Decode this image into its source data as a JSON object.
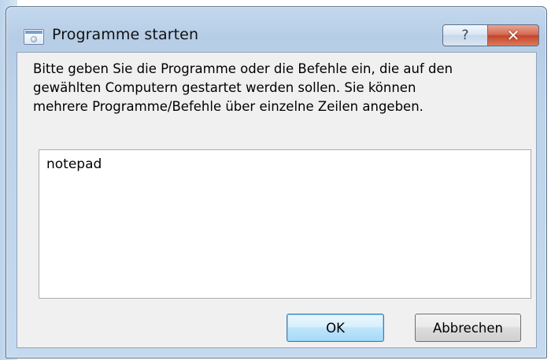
{
  "window": {
    "title": "Programme starten",
    "help_label": "?",
    "close_label": "✕"
  },
  "dialog": {
    "instruction_lines": [
      "Bitte geben Sie die Programme oder die Befehle ein, die auf den",
      "gewählten Computern gestartet werden sollen. Sie können",
      "mehrere Programme/Befehle über einzelne Zeilen angeben."
    ],
    "commands_value": "notepad",
    "ok_label": "OK",
    "cancel_label": "Abbrechen"
  },
  "icons": {
    "app": "window-app-icon",
    "help": "help-icon",
    "close": "close-icon"
  }
}
